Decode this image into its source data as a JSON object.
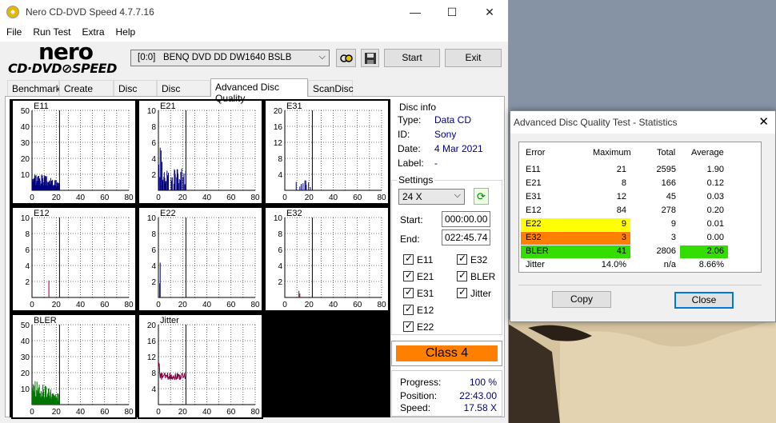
{
  "main": {
    "title": "Nero CD-DVD Speed 4.7.7.16",
    "menu": [
      "File",
      "Run Test",
      "Extra",
      "Help"
    ],
    "logo_top": "nero",
    "logo_bottom": "CD·DVD⊘SPEED",
    "drive": "[0:0]   BENQ DVD DD DW1640 BSLB",
    "start_label": "Start",
    "exit_label": "Exit",
    "tabs": [
      "Benchmark",
      "Create Disc",
      "Disc Info",
      "Disc Quality",
      "Advanced Disc Quality",
      "ScanDisc"
    ],
    "active_tab": 4
  },
  "disc_info": {
    "legend": "Disc info",
    "type_label": "Type:",
    "type": "Data CD",
    "id_label": "ID:",
    "id": "Sony",
    "date_label": "Date:",
    "date": "4 Mar 2021",
    "label_label": "Label:",
    "label": "-"
  },
  "settings": {
    "legend": "Settings",
    "speed": "24 X",
    "start_label": "Start:",
    "start": "000:00.00",
    "end_label": "End:",
    "end": "022:45.74",
    "checks": [
      "E11",
      "E32",
      "E21",
      "BLER",
      "E31",
      "Jitter",
      "E12",
      "E22"
    ]
  },
  "class_label": "Class 4",
  "colors": {
    "class_bg": "#ff8000",
    "e22": "#ffff00",
    "e32": "#ff8000",
    "bler_pass": "#33dd00",
    "series_blue": "#000080",
    "series_green": "#007700",
    "series_jitter": "#800040"
  },
  "progress": {
    "progress_label": "Progress:",
    "progress": "100 %",
    "position_label": "Position:",
    "position": "22:43.00",
    "speed_label": "Speed:",
    "speed": "17.58 X"
  },
  "charts": [
    {
      "name": "E11",
      "yticks": [
        "50",
        "40",
        "30",
        "20",
        "10"
      ],
      "xticks": [
        "0",
        "20",
        "40",
        "60",
        "80"
      ]
    },
    {
      "name": "E21",
      "yticks": [
        "10",
        "8",
        "6",
        "4",
        "2"
      ],
      "xticks": [
        "0",
        "20",
        "40",
        "60",
        "80"
      ]
    },
    {
      "name": "E31",
      "yticks": [
        "20",
        "16",
        "12",
        "8",
        "4"
      ],
      "xticks": [
        "0",
        "20",
        "40",
        "60",
        "80"
      ]
    },
    {
      "name": "E12",
      "yticks": [
        "10",
        "8",
        "6",
        "4",
        "2"
      ],
      "xticks": [
        "0",
        "20",
        "40",
        "60",
        "80"
      ]
    },
    {
      "name": "E22",
      "yticks": [
        "10",
        "8",
        "6",
        "4",
        "2"
      ],
      "xticks": [
        "0",
        "20",
        "40",
        "60",
        "80"
      ]
    },
    {
      "name": "E32",
      "yticks": [
        "10",
        "8",
        "6",
        "4",
        "2"
      ],
      "xticks": [
        "0",
        "20",
        "40",
        "60",
        "80"
      ]
    },
    {
      "name": "BLER",
      "yticks": [
        "50",
        "40",
        "30",
        "20",
        "10"
      ],
      "xticks": [
        "0",
        "20",
        "40",
        "60",
        "80"
      ]
    },
    {
      "name": "Jitter",
      "yticks": [
        "20",
        "16",
        "12",
        "8",
        "4"
      ],
      "xticks": [
        "0",
        "20",
        "40",
        "60",
        "80"
      ]
    }
  ],
  "stats": {
    "title": "Advanced Disc Quality Test - Statistics",
    "headers": [
      "Error",
      "Maximum",
      "Total",
      "Average"
    ],
    "rows": [
      {
        "error": "E11",
        "max": "21",
        "total": "2595",
        "avg": "1.90"
      },
      {
        "error": "E21",
        "max": "8",
        "total": "166",
        "avg": "0.12"
      },
      {
        "error": "E31",
        "max": "12",
        "total": "45",
        "avg": "0.03"
      },
      {
        "error": "E12",
        "max": "84",
        "total": "278",
        "avg": "0.20"
      },
      {
        "error": "E22",
        "max": "9",
        "total": "9",
        "avg": "0.01"
      },
      {
        "error": "E32",
        "max": "3",
        "total": "3",
        "avg": "0.00"
      },
      {
        "error": "BLER",
        "max": "41",
        "total": "2806",
        "avg": "2.06"
      },
      {
        "error": "Jitter",
        "max": "14.0%",
        "total": "n/a",
        "avg": "8.66%"
      }
    ],
    "copy_label": "Copy",
    "close_label": "Close"
  }
}
